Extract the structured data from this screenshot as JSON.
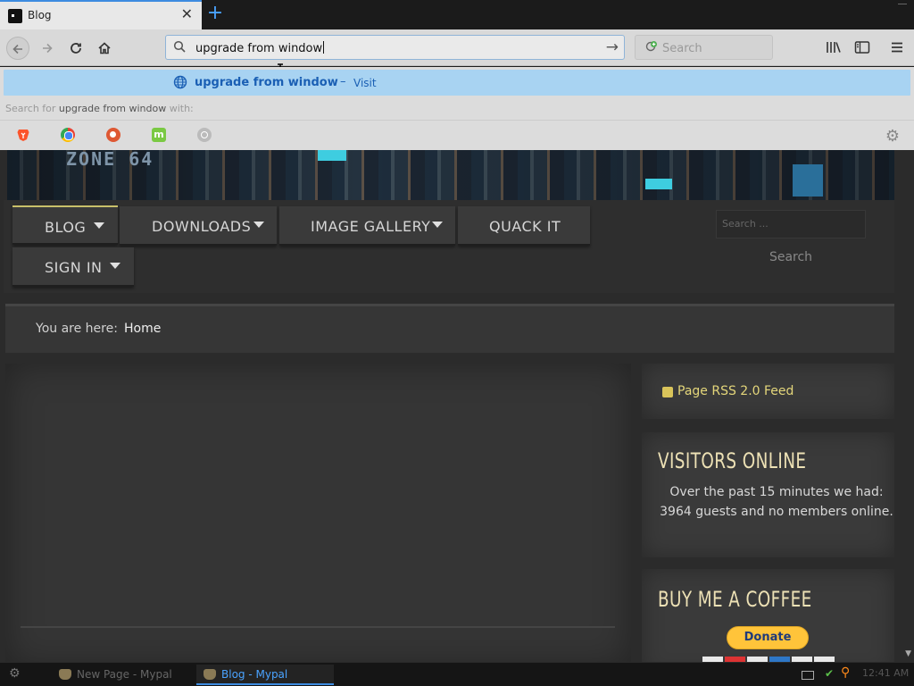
{
  "browser": {
    "tab": {
      "title": "Blog",
      "close": "✕"
    },
    "new_tab": "+",
    "url_text": "upgrade from window",
    "search_placeholder": "Search"
  },
  "dropdown": {
    "suggestion": "upgrade from window",
    "dash": "–",
    "visit": "Visit",
    "search_with_prefix": "Search for ",
    "search_with_query": "upgrade from window",
    "search_with_suffix": " with:",
    "engines": [
      "brave",
      "chrome",
      "duckduckgo",
      "mojeek",
      "generic-search"
    ],
    "mojeek_letter": "m"
  },
  "site": {
    "logo": "ZONE 64",
    "menu": [
      {
        "label": "BLOG",
        "has_submenu": true,
        "active": true
      },
      {
        "label": "DOWNLOADS",
        "has_submenu": true
      },
      {
        "label": "IMAGE GALLERY",
        "has_submenu": true
      },
      {
        "label": "QUACK IT",
        "has_submenu": false
      },
      {
        "label": "SIGN IN",
        "has_submenu": true
      }
    ],
    "search_placeholder": "Search ...",
    "search_button": "Search",
    "breadcrumb_prefix": "You are here:",
    "breadcrumb_home": "Home",
    "rss_link": "Page RSS 2.0 Feed",
    "visitors_heading": "VISITORS ONLINE",
    "visitors_text": "Over the past 15 minutes we had: 3964 guests and no members online.",
    "coffee_heading": "BUY ME A COFFEE",
    "donate_label": "Donate"
  },
  "taskbar": {
    "tasks": [
      {
        "label": "New Page - Mypal",
        "active": false
      },
      {
        "label": "Blog - Mypal",
        "active": true
      }
    ],
    "clock": "12:41 AM"
  },
  "colors": {
    "accent": "#3d8be0",
    "suggestion_bg": "#a8d3f2",
    "heading_cream": "#ede1b5",
    "rss_gold": "#e4d67a",
    "donate_yellow": "#ffc43a"
  }
}
